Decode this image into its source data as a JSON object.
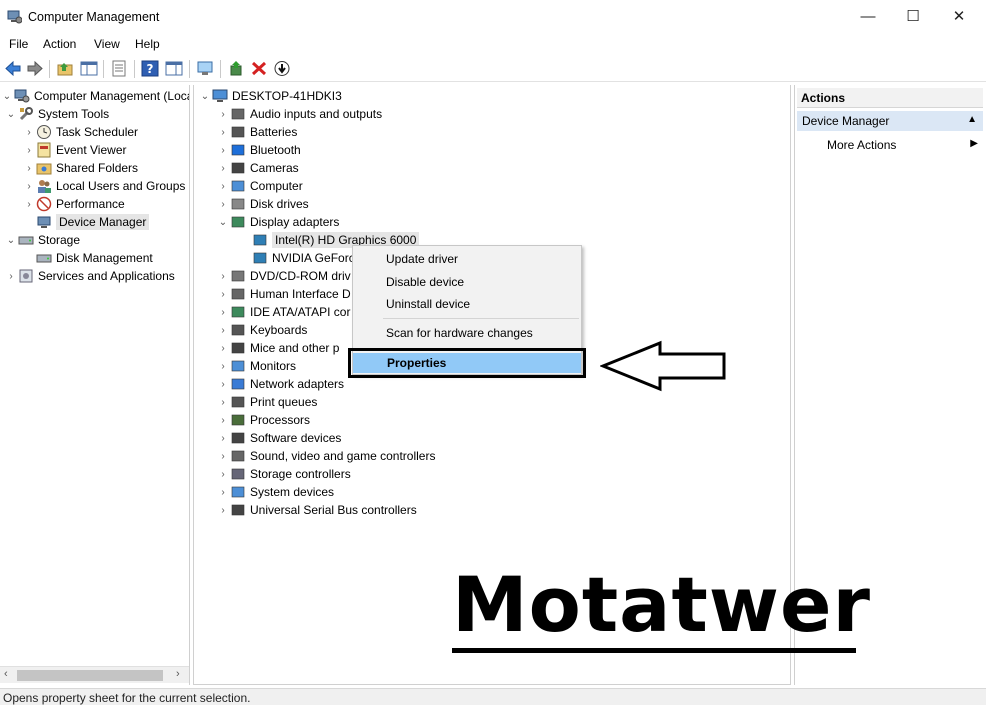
{
  "window": {
    "title": "Computer Management",
    "controls": {
      "minimize": "—",
      "maximize": "☐",
      "close": "✕"
    }
  },
  "menu": [
    "File",
    "Action",
    "View",
    "Help"
  ],
  "left_tree": {
    "root": "Computer Management (Local",
    "system_tools": "System Tools",
    "task_scheduler": "Task Scheduler",
    "event_viewer": "Event Viewer",
    "shared_folders": "Shared Folders",
    "local_users": "Local Users and Groups",
    "performance": "Performance",
    "device_manager": "Device Manager",
    "storage": "Storage",
    "disk_management": "Disk Management",
    "services_apps": "Services and Applications"
  },
  "device_tree": {
    "computer": "DESKTOP-41HDKI3",
    "categories": [
      "Audio inputs and outputs",
      "Batteries",
      "Bluetooth",
      "Cameras",
      "Computer",
      "Disk drives",
      "Display adapters",
      "Intel(R) HD Graphics 6000",
      "NVIDIA GeForc",
      "DVD/CD-ROM driv",
      "Human Interface D",
      "IDE ATA/ATAPI cor",
      "Keyboards",
      "Mice and other p",
      "Monitors",
      "Network adapters",
      "Print queues",
      "Processors",
      "Software devices",
      "Sound, video and game controllers",
      "Storage controllers",
      "System devices",
      "Universal Serial Bus controllers"
    ]
  },
  "context_menu": {
    "update_driver": "Update driver",
    "disable_device": "Disable device",
    "uninstall_device": "Uninstall device",
    "scan_hardware": "Scan for hardware changes",
    "properties": "Properties"
  },
  "actions": {
    "header": "Actions",
    "section": "Device Manager",
    "more_actions": "More Actions"
  },
  "status": "Opens property sheet for the current selection.",
  "watermark": "Motatwer",
  "colors": {
    "selection_blue": "#91c9f7",
    "actions_section": "#dbe7f5"
  }
}
